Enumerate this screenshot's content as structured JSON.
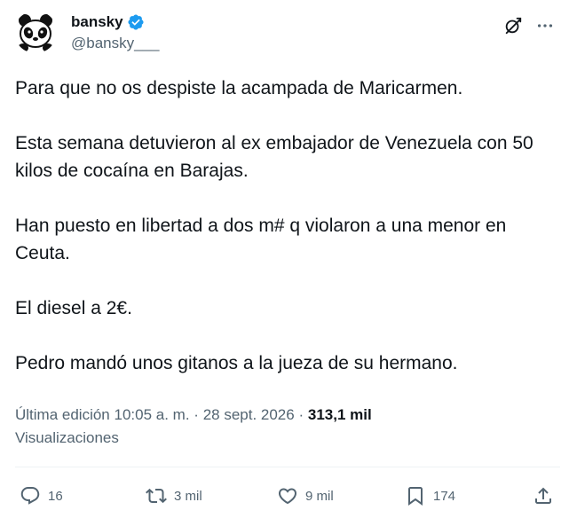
{
  "author": {
    "display_name": "bansky",
    "handle": "@bansky___",
    "verified": true,
    "avatar_icon": "panda-avatar-icon"
  },
  "header": {
    "grok_icon": "grok-icon",
    "more_icon": "more-horizontal-icon"
  },
  "body": {
    "paragraphs": [
      "Para que no os despiste la acampada de Maricarmen.",
      "Esta semana detuvieron al ex embajador de Venezuela con 50 kilos de cocaína en Barajas.",
      "Han puesto en libertad a dos m# q violaron a una menor en Ceuta.",
      "El diesel a 2€.",
      "Pedro mandó unos gitanos a la jueza de su hermano."
    ]
  },
  "meta": {
    "edited": "Última edición 10:05 a. m.",
    "separator": "·",
    "date": "28 sept. 2026",
    "views_count": "313,1 mil",
    "views_label": "Visualizaciones"
  },
  "actions": {
    "replies": "16",
    "retweets": "3 mil",
    "likes": "9 mil",
    "bookmarks": "174"
  },
  "colors": {
    "text": "#0f1419",
    "secondary": "#536471",
    "verified": "#1d9bf0",
    "divider": "#eff3f4"
  }
}
